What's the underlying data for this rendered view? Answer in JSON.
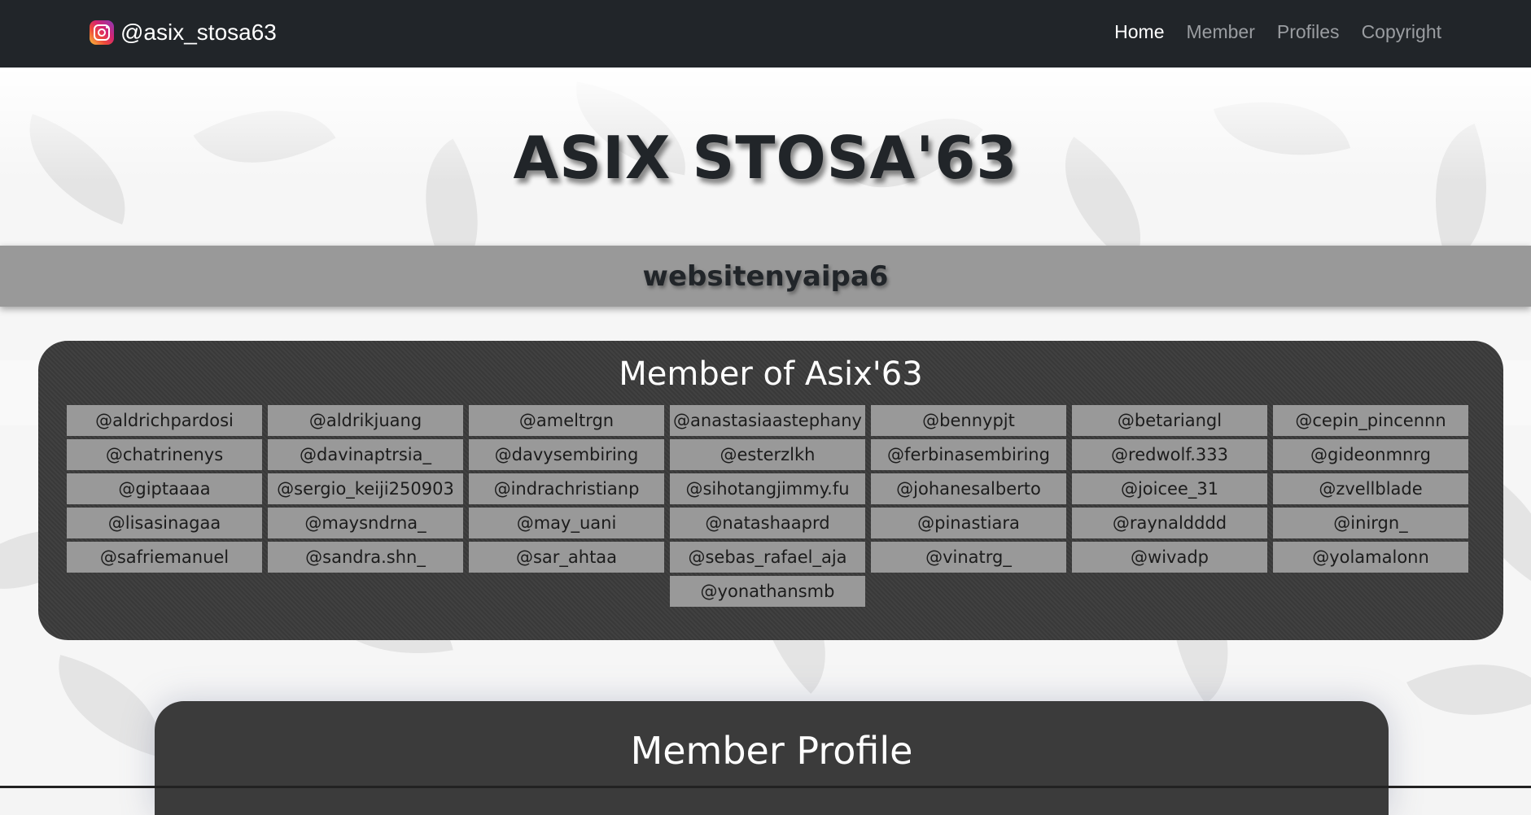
{
  "navbar": {
    "brand": "@asix_stosa63",
    "links": [
      "Home",
      "Member",
      "Profiles",
      "Copyright"
    ],
    "active": "Home"
  },
  "hero": {
    "title": "ASIX STOSA'63"
  },
  "banner": {
    "text": "websitenyaipa6"
  },
  "members": {
    "title": "Member of Asix'63",
    "handles": [
      "@aldrichpardosi",
      "@aldrikjuang",
      "@ameltrgn",
      "@anastasiaastephany",
      "@bennypjt",
      "@betariangl",
      "@cepin_pincennn",
      "@chatrinenys",
      "@davinaptrsia_",
      "@davysembiring",
      "@esterzlkh",
      "@ferbinasembiring",
      "@redwolf.333",
      "@gideonmnrg",
      "@giptaaaa",
      "@sergio_keiji250903",
      "@indrachristianp",
      "@sihotangjimmy.fu",
      "@johanesalberto",
      "@joicee_31",
      "@zvellblade",
      "@lisasinagaa",
      "@maysndrna_",
      "@may_uani",
      "@natashaaprd",
      "@pinastiara",
      "@raynaldddd",
      "@inirgn_",
      "@safriemanuel",
      "@sandra.shn_",
      "@sar_ahtaa",
      "@sebas_rafael_aja",
      "@vinatrg_",
      "@wivadp",
      "@yolamalonn",
      "@yonathansmb"
    ]
  },
  "profile": {
    "title": "Member Profile"
  },
  "colors": {
    "navbar": "#212529",
    "panel": "#3b3b3b",
    "cell": "#999999"
  }
}
